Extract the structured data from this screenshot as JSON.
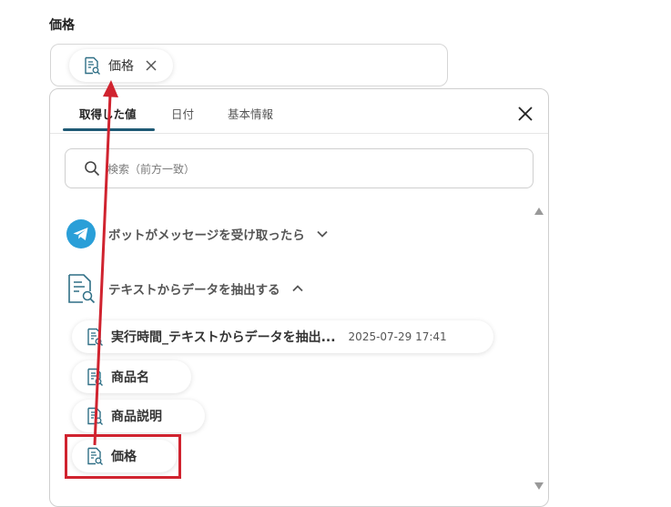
{
  "field": {
    "label": "価格"
  },
  "selected_chip": {
    "label": "価格"
  },
  "tabs": [
    {
      "label": "取得した値",
      "active": true
    },
    {
      "label": "日付",
      "active": false
    },
    {
      "label": "基本情報",
      "active": false
    }
  ],
  "search": {
    "placeholder": "検索（前方一致）",
    "value": ""
  },
  "groups": [
    {
      "label": "ボットがメッセージを受け取ったら",
      "icon": "telegram-icon",
      "expanded": false
    },
    {
      "label": "テキストからデータを抽出する",
      "icon": "document-search-icon",
      "expanded": true
    }
  ],
  "values": [
    {
      "label": "実行時間_テキストからデータを抽出...",
      "date": "2025-07-29 17:41"
    },
    {
      "label": "商品名",
      "date": ""
    },
    {
      "label": "商品説明",
      "date": ""
    },
    {
      "label": "価格",
      "date": ""
    }
  ],
  "colors": {
    "accent": "#1f5a75",
    "annotation": "#d0232f",
    "telegram": "#2a9fd8",
    "icon_teal": "#2f6f86"
  }
}
